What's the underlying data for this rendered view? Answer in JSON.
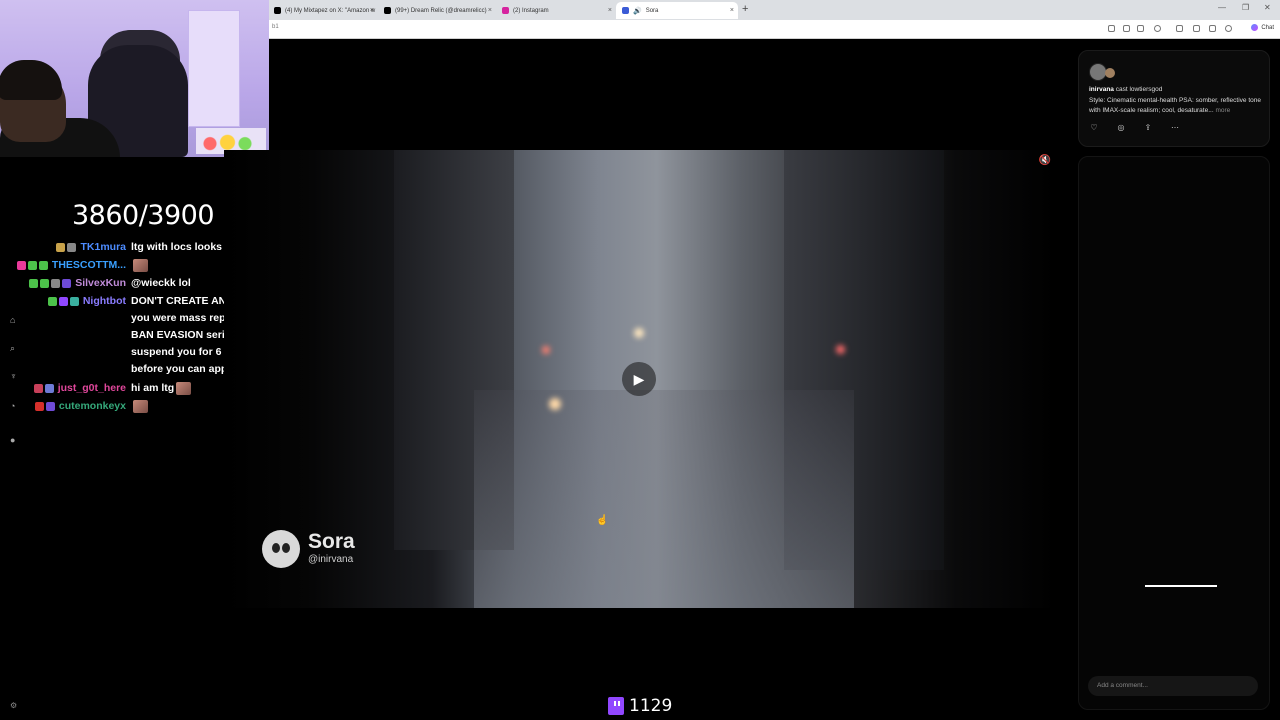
{
  "browser": {
    "tabs": [
      {
        "label": "(4) My Mixtapez on X: \"Amazon w",
        "icon_color": "#000000",
        "active": false
      },
      {
        "label": "(99+) Dream Relic (@dreamrelicc)",
        "icon_color": "#000000",
        "active": false
      },
      {
        "label": "(2) Instagram",
        "icon_color": "#d6249f",
        "active": false
      },
      {
        "label": "Sora",
        "icon_color": "#3b5bd6",
        "active": true
      }
    ],
    "tab_close": "×",
    "new_tab": "+",
    "window_controls": [
      "—",
      "❐",
      "✕"
    ],
    "address_text": "b1",
    "chat_button": "Chat"
  },
  "overlay": {
    "goal": "3860/3900",
    "viewer_count": "1129"
  },
  "chat": {
    "messages": [
      {
        "user": "TK1mura",
        "color": "#4d8cff",
        "text": "ltg with locs looks so wrong",
        "badges": [
          "#c8a24a",
          "#888888"
        ],
        "emote": false
      },
      {
        "user": "THESCOTTM...",
        "color": "#3aa0ff",
        "text": "",
        "badges": [
          "#e83a9a",
          "#4cc24a",
          "#4cc24a"
        ],
        "emote": true
      },
      {
        "user": "SilvexKun",
        "color": "#c08cd9",
        "text": "@wieckk lol",
        "badges": [
          "#4cc24a",
          "#4cc24a",
          "#888888",
          "#6e4bd6"
        ],
        "emote": false
      },
      {
        "user": "Nightbot",
        "color": "#8a7cff",
        "text": "DON'T CREATE AN ALT ACCOUNT if you were mass reported. Twitch takes BAN EVASION seriously and they will suspend you for 6 months minimum before you can appeal.",
        "badges": [
          "#4cc24a",
          "#9147ff",
          "#3ab0a0"
        ],
        "emote": false
      },
      {
        "user": "just_g0t_here",
        "color": "#e0479b",
        "text": "hi am ltg",
        "badges": [
          "#c8405a",
          "#6e7bd6"
        ],
        "emote": true
      },
      {
        "user": "cutemonkeyx",
        "color": "#35a87a",
        "text": "",
        "badges": [
          "#d6302b",
          "#6e4bd6"
        ],
        "emote": true
      }
    ]
  },
  "video": {
    "watermark_title": "Sora",
    "watermark_handle": "@inirvana"
  },
  "post": {
    "user": "inirvana",
    "action": "cast lowtiersgod",
    "text": "Style: Cinematic mental-health PSA: somber, reflective tone with IMAX-scale realism; cool, desaturate...",
    "more": "more",
    "comment_placeholder": "Add a comment..."
  }
}
